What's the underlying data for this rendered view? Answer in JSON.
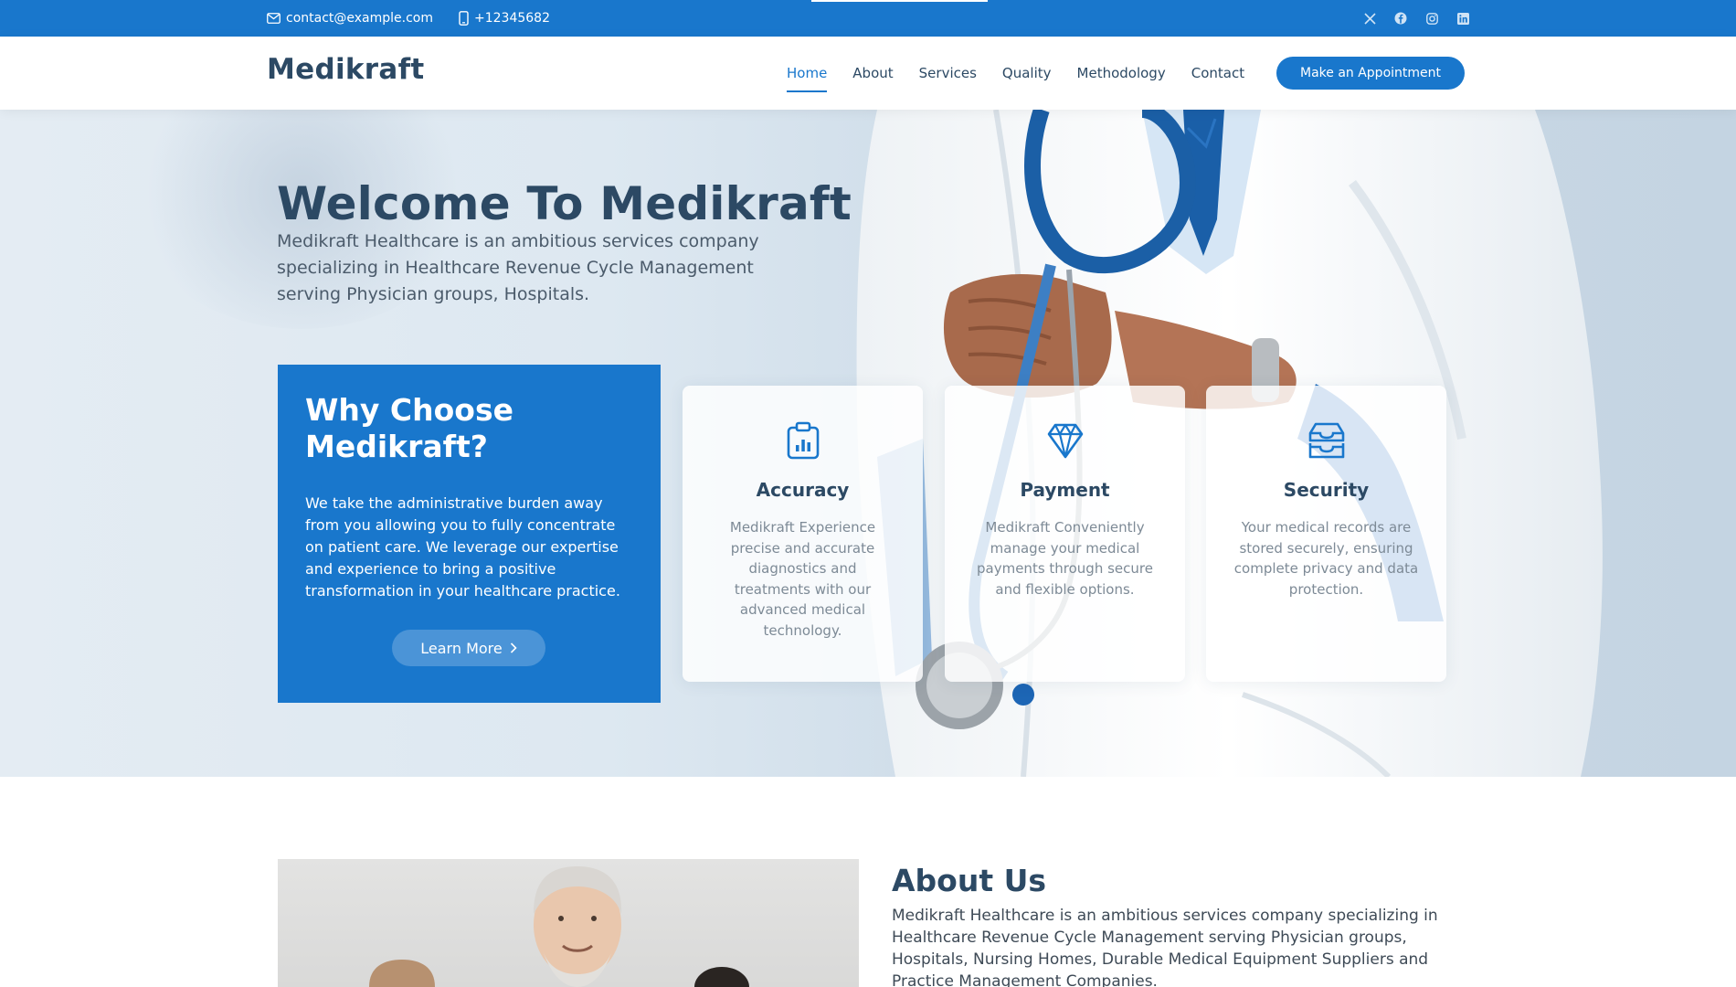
{
  "topbar": {
    "email": "contact@example.com",
    "phone": "+12345682",
    "social": [
      "x-icon",
      "facebook-icon",
      "instagram-icon",
      "linkedin-icon"
    ]
  },
  "header": {
    "logo": "Medikraft",
    "nav": [
      {
        "label": "Home",
        "active": true
      },
      {
        "label": "About"
      },
      {
        "label": "Services"
      },
      {
        "label": "Quality"
      },
      {
        "label": "Methodology"
      },
      {
        "label": "Contact"
      }
    ],
    "cta": "Make an Appointment"
  },
  "hero": {
    "title": "Welcome To Medikraft",
    "lead": "Medikraft Healthcare is an ambitious services company specializing in Healthcare Revenue Cycle Management serving Physician groups, Hospitals.",
    "why": {
      "title": "Why Choose Medikraft?",
      "text": "We take the administrative burden away from you allowing you to fully concentrate on patient care. We leverage our expertise and experience to bring a positive transformation in your healthcare practice.",
      "button": "Learn More"
    },
    "cards": [
      {
        "icon": "clipboard-data-icon",
        "title": "Accuracy",
        "text": "Medikraft Experience precise and accurate diagnostics and treatments with our advanced medical technology."
      },
      {
        "icon": "gem-icon",
        "title": "Payment",
        "text": "Medikraft Conveniently manage your medical payments through secure and flexible options."
      },
      {
        "icon": "inboxes-icon",
        "title": "Security",
        "text": "Your medical records are stored securely, ensuring complete privacy and data protection."
      }
    ]
  },
  "about": {
    "title": "About Us",
    "text": "Medikraft Healthcare is an ambitious services company specializing in Healthcare Revenue Cycle Management serving Physician groups, Hospitals, Nursing Homes, Durable Medical Equipment Suppliers and Practice Management Companies."
  },
  "colors": {
    "accent": "#1977cc",
    "heading": "#2c4964"
  }
}
